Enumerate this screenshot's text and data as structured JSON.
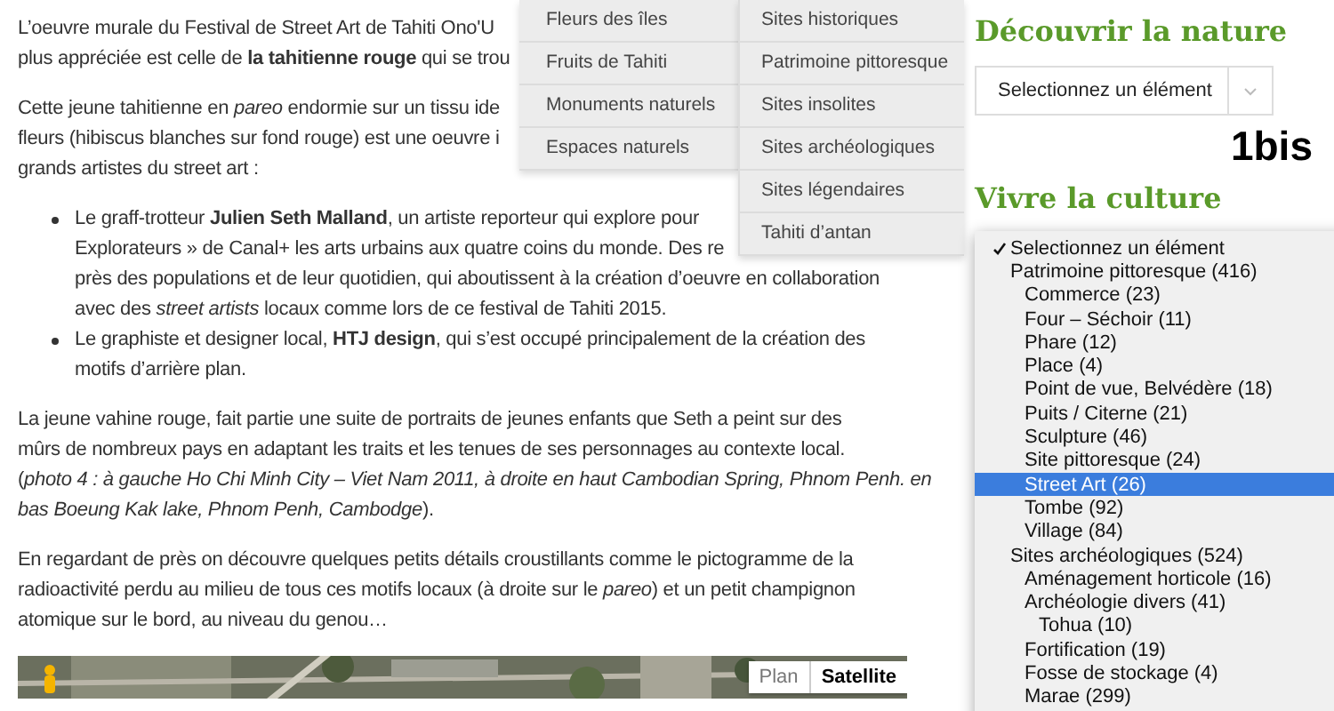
{
  "article": {
    "blocks": [
      {
        "kind": "text",
        "lines": [
          "L’oeuvre murale du Festival de Street Art de Tahiti Ono'U",
          "plus appréciée est celle de **la tahitienne rouge** qui se trou"
        ]
      },
      {
        "kind": "text",
        "lines": [
          "Cette jeune tahitienne en *pareo* endormie sur un tissu ide",
          "fleurs (hibiscus blanches sur fond rouge) est une oeuvre i",
          "grands artistes du street art :"
        ]
      },
      {
        "kind": "list",
        "items": [
          {
            "lines": [
              "Le graff-trotteur **Julien Seth Malland**, un artiste reporteur qui explore pour",
              "Explorateurs » de Canal+ les arts urbains aux quatre coins du monde. Des re",
              "près des populations et de leur quotidien, qui aboutissent à la création d’oeuvre en  collaboration",
              "avec des *street artists* locaux comme lors de ce festival de Tahiti 2015."
            ]
          },
          {
            "lines": [
              "Le graphiste et designer local, **HTJ design**, qui s’est occupé principalement de la création des",
              "motifs d’arrière plan."
            ]
          }
        ]
      },
      {
        "kind": "text",
        "lines": [
          "La jeune vahine rouge, fait partie une suite de portraits de jeunes enfants que Seth a peint sur des",
          "mûrs de nombreux pays en adaptant les traits et les tenues de ses personnages au contexte local.",
          "(*photo 4 : à gauche Ho Chi Minh City – Viet Nam 2011, à droite en haut Cambodian Spring, Phnom Penh. en*",
          "*bas Boeung Kak lake, Phnom Penh, Cambodge*)."
        ]
      },
      {
        "kind": "text",
        "lines": [
          "En regardant de près on découvre quelques petits détails croustillants comme le pictogramme de la",
          "radioactivité perdu au milieu de tous ces motifs locaux (à droite sur le *pareo*) et un petit champignon",
          "atomique sur le bord, au niveau du genou…"
        ]
      }
    ],
    "map": {
      "kind": "picture",
      "map_types": [
        {
          "label": "Plan",
          "selected": false
        },
        {
          "label": "Satellite",
          "selected": true
        }
      ]
    }
  },
  "mega_menu": {
    "columns": [
      [
        "Fleurs des îles",
        "Fruits de Tahiti",
        "Monuments naturels",
        "Espaces naturels"
      ],
      [
        "Sites historiques",
        "Patrimoine pittoresque",
        "Sites insolites",
        "Sites archéologiques",
        "Sites légendaires",
        "Tahiti d’antan"
      ]
    ]
  },
  "sidebar": {
    "sections": [
      {
        "title": "Découvrir la nature",
        "select": "Selectionnez un élément",
        "note": "1bis"
      },
      {
        "title": "Vivre la culture"
      }
    ],
    "dropdown": {
      "options": [
        {
          "label": "Selectionnez un élément",
          "checked": true,
          "selected": false
        },
        {
          "label": "Patrimoine pittoresque  (416)",
          "checked": false,
          "selected": false,
          "children": [
            {
              "label": "Commerce  (23)",
              "checked": false,
              "selected": false
            },
            {
              "label": "Four – Séchoir  (11)",
              "checked": false,
              "selected": false
            },
            {
              "label": "Phare  (12)",
              "checked": false,
              "selected": false
            },
            {
              "label": "Place  (4)",
              "checked": false,
              "selected": false
            },
            {
              "label": "Point de vue, Belvédère  (18)",
              "checked": false,
              "selected": false
            },
            {
              "label": "Puits / Citerne  (21)",
              "checked": false,
              "selected": false
            },
            {
              "label": "Sculpture  (46)",
              "checked": false,
              "selected": false
            },
            {
              "label": "Site pittoresque  (24)",
              "checked": false,
              "selected": false
            },
            {
              "label": "Street Art  (26)",
              "checked": false,
              "selected": true
            },
            {
              "label": "Tombe  (92)",
              "checked": false,
              "selected": false
            },
            {
              "label": "Village  (84)",
              "checked": false,
              "selected": false
            }
          ]
        },
        {
          "label": "Sites archéologiques  (524)",
          "checked": false,
          "selected": false,
          "children": [
            {
              "label": "Aménagement horticole  (16)",
              "checked": false,
              "selected": false
            },
            {
              "label": "Archéologie divers  (41)",
              "checked": false,
              "selected": false,
              "children": [
                {
                  "label": "Tohua  (10)",
                  "checked": false,
                  "selected": false
                }
              ]
            },
            {
              "label": "Fortification  (19)",
              "checked": false,
              "selected": false
            },
            {
              "label": "Fosse de stockage  (4)",
              "checked": false,
              "selected": false
            },
            {
              "label": "Marae  (299)",
              "checked": false,
              "selected": false
            }
          ]
        }
      ]
    }
  }
}
